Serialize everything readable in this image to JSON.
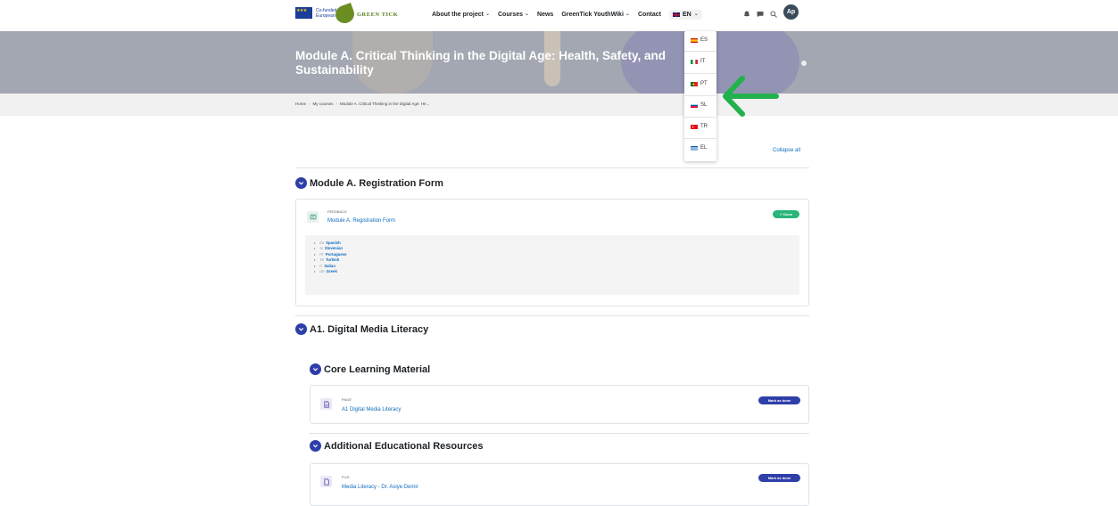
{
  "nav": {
    "eu_text": "Co-funded by the European Union",
    "brand": "GREEN TICK",
    "items": [
      {
        "label": "About the project",
        "caret": true
      },
      {
        "label": "Courses",
        "caret": true
      },
      {
        "label": "News",
        "caret": false
      },
      {
        "label": "GreenTick YouthWiki",
        "caret": true
      },
      {
        "label": "Contact",
        "caret": false
      }
    ],
    "current_lang": "EN",
    "avatar": "Ap"
  },
  "banner": {
    "title": "Module A. Critical Thinking in the Digital Age: Health, Safety, and Sustainability"
  },
  "breadcrumb": [
    "Home",
    "My courses",
    "Module A. Critical Thinking in the Digital Age: He..."
  ],
  "language_dropdown": [
    {
      "code": "ES",
      "flag": [
        "#c60b1e",
        "#ffc400",
        "#c60b1e"
      ]
    },
    {
      "code": "IT",
      "flag": [
        "#009246",
        "#ffffff",
        "#ce2b37"
      ]
    },
    {
      "code": "PT",
      "flag": [
        "#046a38",
        "#da291c",
        "#da291c"
      ]
    },
    {
      "code": "SL",
      "flag": [
        "#ffffff",
        "#0056a8",
        "#e4002b"
      ]
    },
    {
      "code": "TR",
      "flag": [
        "#e30a17",
        "#e30a17",
        "#e30a17"
      ]
    },
    {
      "code": "EL",
      "flag": [
        "#0d5eaf",
        "#ffffff",
        "#0d5eaf"
      ]
    }
  ],
  "course": {
    "collapse_all": "Collapse all",
    "section1": {
      "title": "Module A. Registration Form",
      "activity_type": "FEEDBACK",
      "activity_name": "Module A. Registration Form",
      "status": "Done",
      "languages": [
        {
          "code": "ES",
          "name": "Spanish"
        },
        {
          "code": "SI",
          "name": "Slovenian"
        },
        {
          "code": "PT",
          "name": "Portuguese"
        },
        {
          "code": "TR",
          "name": "Turkish"
        },
        {
          "code": "IT",
          "name": "Italian"
        },
        {
          "code": "GR",
          "name": "Greek"
        }
      ]
    },
    "section2": {
      "title": "A1. Digital Media Literacy",
      "sub1": {
        "title": "Core Learning Material",
        "activity_type": "PAGE",
        "activity_name": "A1 Digital Media Literacy",
        "button": "Mark as done"
      },
      "sub2": {
        "title": "Additional Educational Resources",
        "activity_type": "FILE",
        "activity_name": "Media Literacy - Dr. Asiye Demir",
        "button": "Mark as done"
      }
    }
  },
  "colors": {
    "accent": "#2e3fa8",
    "link": "#0f6cbf",
    "done": "#28b57a",
    "annotation_arrow": "#22b14c"
  }
}
